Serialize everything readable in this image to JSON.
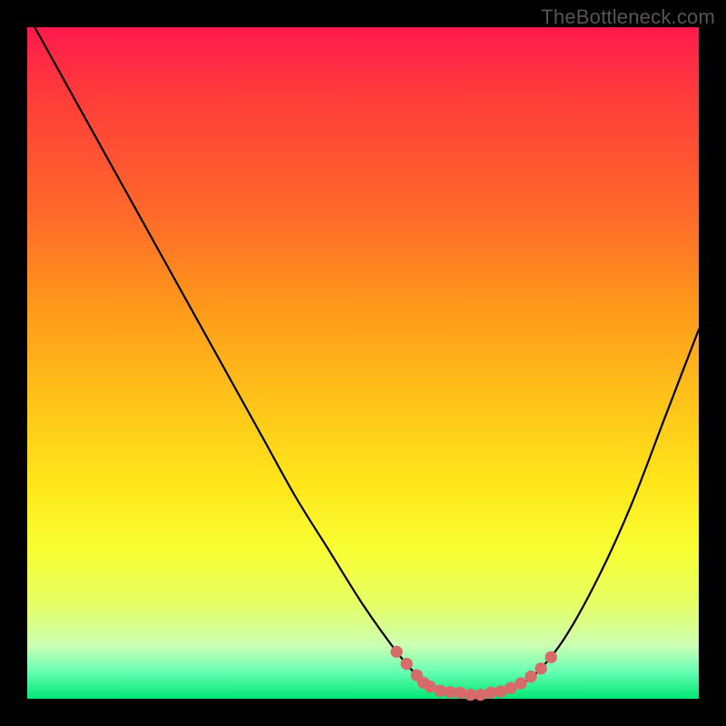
{
  "watermark": {
    "text": "TheBottleneck.com"
  },
  "chart_data": {
    "type": "line",
    "title": "",
    "xlabel": "",
    "ylabel": "",
    "xlim": [
      0,
      100
    ],
    "ylim": [
      0,
      100
    ],
    "grid": false,
    "legend": false,
    "gradient_stops": [
      {
        "pos": 0,
        "color": "#ff1a4d"
      },
      {
        "pos": 10,
        "color": "#ff3b3b"
      },
      {
        "pos": 28,
        "color": "#ff6a2a"
      },
      {
        "pos": 42,
        "color": "#ff9a1a"
      },
      {
        "pos": 56,
        "color": "#ffc41a"
      },
      {
        "pos": 68,
        "color": "#ffe61a"
      },
      {
        "pos": 78,
        "color": "#f7ff33"
      },
      {
        "pos": 86,
        "color": "#e6ff66"
      },
      {
        "pos": 92,
        "color": "#ccffb3"
      },
      {
        "pos": 96,
        "color": "#66ffb3"
      },
      {
        "pos": 100,
        "color": "#00e673"
      }
    ],
    "series": [
      {
        "name": "bottleneck-curve",
        "x": [
          0,
          5,
          10,
          15,
          20,
          25,
          30,
          35,
          40,
          45,
          50,
          55,
          58,
          60,
          62,
          65,
          68,
          70,
          73,
          76,
          80,
          85,
          90,
          95,
          100
        ],
        "y": [
          102,
          93,
          84,
          75,
          66,
          57,
          48,
          39,
          30,
          22,
          14,
          7,
          3.5,
          1.8,
          1,
          0.6,
          0.6,
          1,
          2,
          4,
          9,
          18,
          29,
          42,
          55
        ]
      }
    ],
    "markers": {
      "name": "dotted-valley",
      "color": "#d86a6a",
      "radius_pct": 0.9,
      "points": [
        {
          "x": 55.0,
          "y": 7.0
        },
        {
          "x": 56.5,
          "y": 5.2
        },
        {
          "x": 58.0,
          "y": 3.5
        },
        {
          "x": 59.0,
          "y": 2.4
        },
        {
          "x": 60.0,
          "y": 1.8
        },
        {
          "x": 61.5,
          "y": 1.2
        },
        {
          "x": 63.0,
          "y": 1.0
        },
        {
          "x": 64.5,
          "y": 0.9
        },
        {
          "x": 66.0,
          "y": 0.6
        },
        {
          "x": 67.5,
          "y": 0.6
        },
        {
          "x": 69.0,
          "y": 0.9
        },
        {
          "x": 70.5,
          "y": 1.1
        },
        {
          "x": 72.0,
          "y": 1.6
        },
        {
          "x": 73.5,
          "y": 2.3
        },
        {
          "x": 75.0,
          "y": 3.3
        },
        {
          "x": 76.5,
          "y": 4.5
        },
        {
          "x": 78.0,
          "y": 6.2
        }
      ]
    }
  }
}
